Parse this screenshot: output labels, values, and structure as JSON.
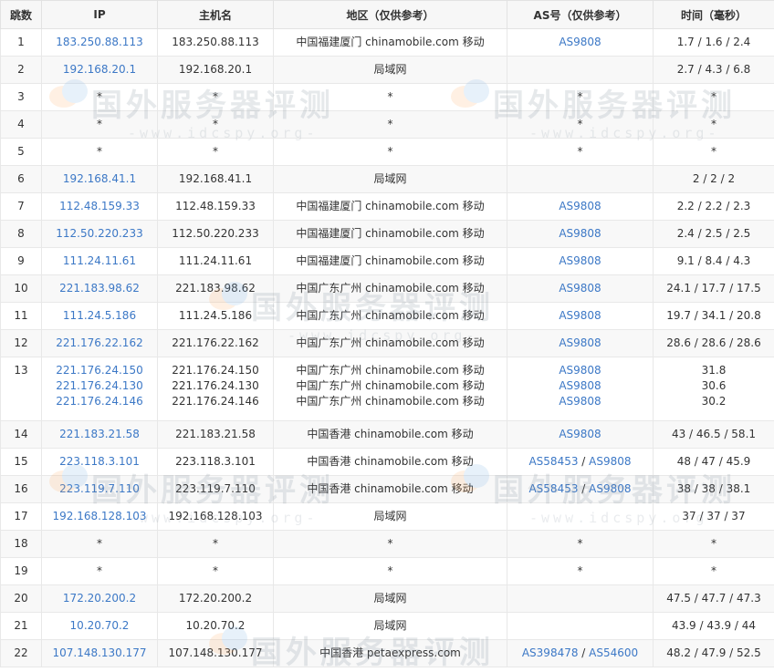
{
  "headers": {
    "hop": "跳数",
    "ip": "IP",
    "host": "主机名",
    "region": "地区（仅供参考）",
    "as": "AS号（仅供参考）",
    "time": "时间（毫秒）"
  },
  "watermark": {
    "main": "国外服务器评测",
    "sub": "-www.idcspy.org-"
  },
  "rows": [
    {
      "hop": "1",
      "ip": "183.250.88.113",
      "host": "183.250.88.113",
      "region": "中国福建厦门 chinamobile.com 移动",
      "as1": "AS9808",
      "as2": "",
      "time": "1.7 / 1.6 / 2.4"
    },
    {
      "hop": "2",
      "ip": "192.168.20.1",
      "host": "192.168.20.1",
      "region": "局域网",
      "as1": "",
      "as2": "",
      "time": "2.7 / 4.3 / 6.8"
    },
    {
      "hop": "3",
      "ip": "*",
      "host": "*",
      "region": "*",
      "as1": "*",
      "as2": "",
      "time": "*"
    },
    {
      "hop": "4",
      "ip": "*",
      "host": "*",
      "region": "*",
      "as1": "*",
      "as2": "",
      "time": "*"
    },
    {
      "hop": "5",
      "ip": "*",
      "host": "*",
      "region": "*",
      "as1": "*",
      "as2": "",
      "time": "*"
    },
    {
      "hop": "6",
      "ip": "192.168.41.1",
      "host": "192.168.41.1",
      "region": "局域网",
      "as1": "",
      "as2": "",
      "time": "2 / 2 / 2"
    },
    {
      "hop": "7",
      "ip": "112.48.159.33",
      "host": "112.48.159.33",
      "region": "中国福建厦门 chinamobile.com 移动",
      "as1": "AS9808",
      "as2": "",
      "time": "2.2 / 2.2 / 2.3"
    },
    {
      "hop": "8",
      "ip": "112.50.220.233",
      "host": "112.50.220.233",
      "region": "中国福建厦门 chinamobile.com 移动",
      "as1": "AS9808",
      "as2": "",
      "time": "2.4 / 2.5 / 2.5"
    },
    {
      "hop": "9",
      "ip": "111.24.11.61",
      "host": "111.24.11.61",
      "region": "中国福建厦门 chinamobile.com 移动",
      "as1": "AS9808",
      "as2": "",
      "time": "9.1 / 8.4 / 4.3"
    },
    {
      "hop": "10",
      "ip": "221.183.98.62",
      "host": "221.183.98.62",
      "region": "中国广东广州 chinamobile.com 移动",
      "as1": "AS9808",
      "as2": "",
      "time": "24.1 / 17.7 / 17.5"
    },
    {
      "hop": "11",
      "ip": "111.24.5.186",
      "host": "111.24.5.186",
      "region": "中国广东广州 chinamobile.com 移动",
      "as1": "AS9808",
      "as2": "",
      "time": "19.7 / 34.1 / 20.8"
    },
    {
      "hop": "12",
      "ip": "221.176.22.162",
      "host": "221.176.22.162",
      "region": "中国广东广州 chinamobile.com 移动",
      "as1": "AS9808",
      "as2": "",
      "time": "28.6 / 28.6 / 28.6"
    },
    {
      "hop": "14",
      "ip": "221.183.21.58",
      "host": "221.183.21.58",
      "region": "中国香港 chinamobile.com 移动",
      "as1": "AS9808",
      "as2": "",
      "time": "43 / 46.5 / 58.1"
    },
    {
      "hop": "15",
      "ip": "223.118.3.101",
      "host": "223.118.3.101",
      "region": "中国香港 chinamobile.com 移动",
      "as1": "AS58453",
      "as2": "AS9808",
      "time": "48 / 47 / 45.9"
    },
    {
      "hop": "16",
      "ip": "223.119.7.110",
      "host": "223.119.7.110",
      "region": "中国香港 chinamobile.com 移动",
      "as1": "AS58453",
      "as2": "AS9808",
      "time": "38 / 38 / 38.1"
    },
    {
      "hop": "17",
      "ip": "192.168.128.103",
      "host": "192.168.128.103",
      "region": "局域网",
      "as1": "",
      "as2": "",
      "time": "37 / 37 / 37"
    },
    {
      "hop": "18",
      "ip": "*",
      "host": "*",
      "region": "*",
      "as1": "*",
      "as2": "",
      "time": "*"
    },
    {
      "hop": "19",
      "ip": "*",
      "host": "*",
      "region": "*",
      "as1": "*",
      "as2": "",
      "time": "*"
    },
    {
      "hop": "20",
      "ip": "172.20.200.2",
      "host": "172.20.200.2",
      "region": "局域网",
      "as1": "",
      "as2": "",
      "time": "47.5 / 47.7 / 47.3"
    },
    {
      "hop": "21",
      "ip": "10.20.70.2",
      "host": "10.20.70.2",
      "region": "局域网",
      "as1": "",
      "as2": "",
      "time": "43.9 / 43.9 / 44"
    },
    {
      "hop": "22",
      "ip": "107.148.130.177",
      "host": "107.148.130.177",
      "region": "中国香港 petaexpress.com",
      "as1": "AS398478",
      "as2": "AS54600",
      "time": "48.2 / 47.9 / 52.5"
    }
  ],
  "multi_hop": {
    "hop": "13",
    "lines": [
      {
        "ip": "221.176.24.150",
        "host": "221.176.24.150",
        "region": "中国广东广州 chinamobile.com 移动",
        "as": "AS9808",
        "time": "31.8"
      },
      {
        "ip": "221.176.24.130",
        "host": "221.176.24.130",
        "region": "中国广东广州 chinamobile.com 移动",
        "as": "AS9808",
        "time": "30.6"
      },
      {
        "ip": "221.176.24.146",
        "host": "221.176.24.146",
        "region": "中国广东广州 chinamobile.com 移动",
        "as": "AS9808",
        "time": "30.2"
      }
    ]
  },
  "as_separator": " / "
}
